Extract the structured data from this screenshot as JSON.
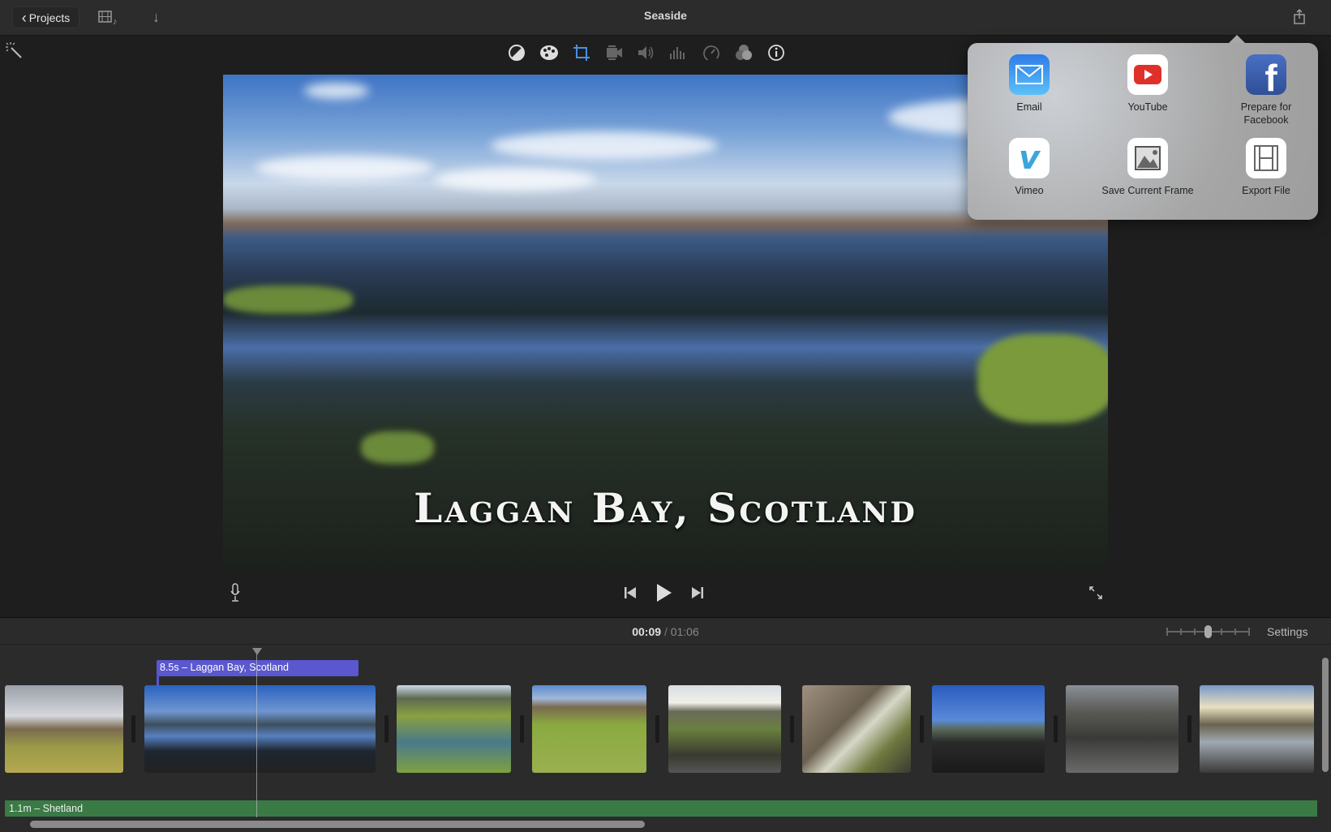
{
  "window": {
    "title": "Seaside"
  },
  "topbar": {
    "projects_label": "Projects"
  },
  "toolbar": {
    "icons": [
      "magic-wand-icon",
      "color-balance-icon",
      "color-correction-icon",
      "crop-icon",
      "stabilization-icon",
      "volume-icon",
      "equalizer-icon",
      "speed-icon",
      "clip-filter-icon",
      "info-icon"
    ],
    "active": "crop-icon",
    "accent": "#4a8fe0"
  },
  "viewer": {
    "title_overlay": "Laggan Bay, Scotland"
  },
  "share_menu": {
    "items": [
      {
        "label": "Email",
        "icon": "email-icon"
      },
      {
        "label": "YouTube",
        "icon": "youtube-icon"
      },
      {
        "label": "Prepare for Facebook",
        "icon": "facebook-icon"
      },
      {
        "label": "Vimeo",
        "icon": "vimeo-icon"
      },
      {
        "label": "Save Current Frame",
        "icon": "image-icon"
      },
      {
        "label": "Export File",
        "icon": "film-icon"
      }
    ]
  },
  "timeline": {
    "current_time": "00:09",
    "separator": "/",
    "total_time": "01:06",
    "settings_label": "Settings",
    "zoom_level": 0.5,
    "title_clip": "8.5s – Laggan Bay, Scotland",
    "audio_clip": "1.1m – Shetland"
  }
}
